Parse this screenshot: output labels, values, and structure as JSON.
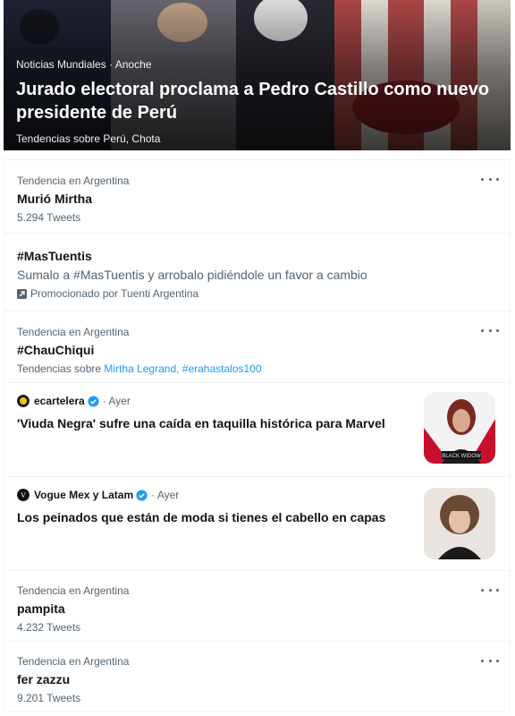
{
  "hero": {
    "meta": "Noticias Mundiales · Anoche",
    "title": "Jurado electoral proclama a Pedro Castillo como nuevo presidente de Perú",
    "subtitle": "Tendencias sobre Perú, Chota"
  },
  "trends": [
    {
      "context": "Tendencia en Argentina",
      "title": "Murió Mirtha",
      "count": "5.294 Tweets"
    },
    {
      "promoted_title": "#MasTuentis",
      "promoted_desc": "Sumalo a #MasTuentis y arrobalo pidiéndole un favor a cambio",
      "promoted_by": "Promocionado por Tuenti Argentina"
    },
    {
      "context": "Tendencia en Argentina",
      "title": "#ChauChiqui",
      "related_prefix": "Tendencias sobre",
      "related_links": "Mirtha Legrand, #erahastalos100"
    },
    {
      "context": "Tendencia en Argentina",
      "title": "pampita",
      "count": "4.232 Tweets"
    },
    {
      "context": "Tendencia en Argentina",
      "title": "fer zazzu",
      "count": "9.201 Tweets"
    }
  ],
  "news": [
    {
      "source": "ecartelera",
      "time": "Ayer",
      "title": "'Viuda Negra' sufre una caída en taquilla histórica para Marvel",
      "thumb_label": "BLACK WIDOW",
      "accent": "#c8102e"
    },
    {
      "source": "Vogue Mex y Latam",
      "time": "Ayer",
      "title": "Los peinados que están de moda si tienes el cabello en capas"
    }
  ],
  "icons": {
    "more": "more-options-icon",
    "verified": "verified-badge-icon",
    "promoted": "promoted-icon"
  },
  "colors": {
    "link": "#1d9bf0",
    "muted": "#536471",
    "text": "#0f1419"
  }
}
